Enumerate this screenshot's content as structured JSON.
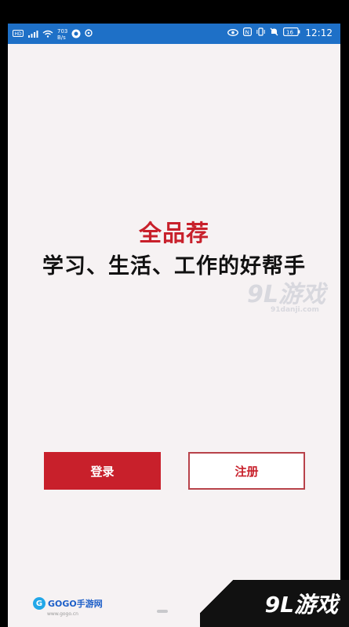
{
  "status_bar": {
    "left_icons": [
      "hd-icon",
      "signal-icon",
      "wifi-icon",
      "speed-text",
      "app-icon",
      "location-icon"
    ],
    "speed_value": "703",
    "speed_unit": "B/s",
    "right_icons": [
      "eye-icon",
      "nfc-icon",
      "vibrate-icon",
      "mute-icon",
      "battery-icon"
    ],
    "battery_text": "16",
    "time": "12:12"
  },
  "app": {
    "title": "全品荐",
    "tagline": "学习、生活、工作的好帮手",
    "login_label": "登录",
    "register_label": "注册"
  },
  "colors": {
    "status_bar": "#1e70c7",
    "brand_red": "#c8202b",
    "background": "#f6f2f3"
  },
  "watermarks": {
    "center_big": "9L游戏",
    "center_small": "91danji.com",
    "bottom_left": "GOGO手游网",
    "bottom_left_sub": "www.gogo.cn",
    "bottom_right": "9L游戏"
  }
}
